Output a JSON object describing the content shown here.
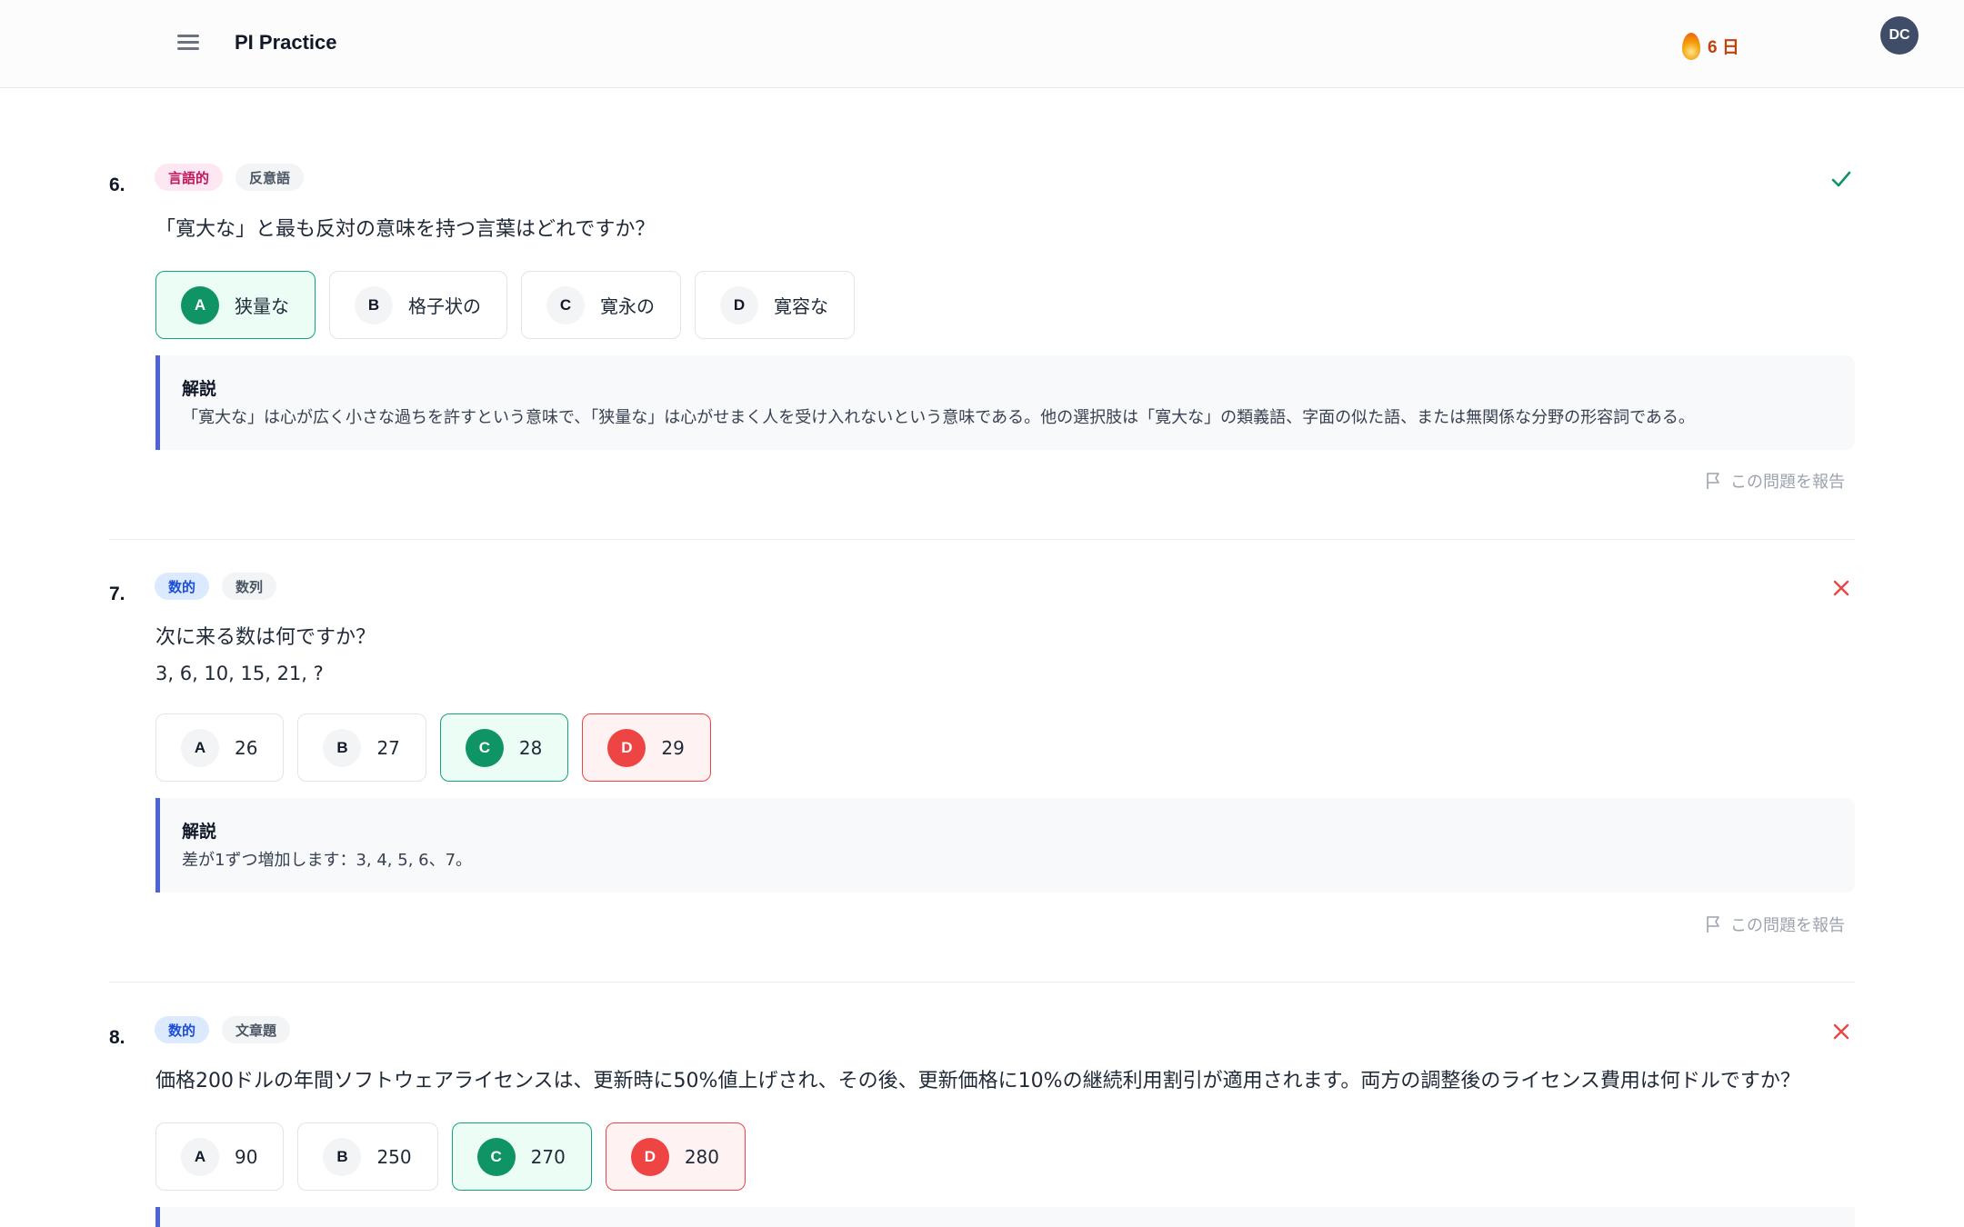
{
  "header": {
    "app_title": "PI Practice",
    "streak_text": "6 日",
    "avatar_initials": "DC"
  },
  "questions": [
    {
      "number": "6.",
      "tags": [
        "言語的",
        "反意語"
      ],
      "status": "correct",
      "text": "「寛大な」と最も反対の意味を持つ言葉はどれですか？",
      "options": [
        {
          "letter": "A",
          "text": "狭量な",
          "state": "correct"
        },
        {
          "letter": "B",
          "text": "格子状の",
          "state": "none"
        },
        {
          "letter": "C",
          "text": "寛永の",
          "state": "none"
        },
        {
          "letter": "D",
          "text": "寛容な",
          "state": "none"
        }
      ],
      "explanation_title": "解説",
      "explanation": "「寛大な」は心が広く小さな過ちを許すという意味で、「狭量な」は心がせまく人を受け入れないという意味である。他の選択肢は「寛大な」の類義語、字面の似た語、または無関係な分野の形容詞である。",
      "report_label": "この問題を報告"
    },
    {
      "number": "7.",
      "tags": [
        "数的",
        "数列"
      ],
      "status": "incorrect",
      "text": "次に来る数は何ですか？",
      "text2": "3, 6, 10, 15, 21, ?",
      "options": [
        {
          "letter": "A",
          "text": "26",
          "state": "none"
        },
        {
          "letter": "B",
          "text": "27",
          "state": "none"
        },
        {
          "letter": "C",
          "text": "28",
          "state": "correct"
        },
        {
          "letter": "D",
          "text": "29",
          "state": "wrong"
        }
      ],
      "explanation_title": "解説",
      "explanation": "差が1ずつ増加します：3, 4, 5, 6、7。",
      "report_label": "この問題を報告"
    },
    {
      "number": "8.",
      "tags": [
        "数的",
        "文章題"
      ],
      "status": "incorrect",
      "text": "価格200ドルの年間ソフトウェアライセンスは、更新時に50%値上げされ、その後、更新価格に10%の継続利用割引が適用されます。両方の調整後のライセンス費用は何ドルですか？",
      "options": [
        {
          "letter": "A",
          "text": "90",
          "state": "none"
        },
        {
          "letter": "B",
          "text": "250",
          "state": "none"
        },
        {
          "letter": "C",
          "text": "270",
          "state": "correct"
        },
        {
          "letter": "D",
          "text": "280",
          "state": "wrong"
        }
      ]
    }
  ],
  "colors": {
    "correct": "#0f9466",
    "wrong": "#ef4444",
    "accent": "#4f63d8",
    "streak": "#c2410c"
  },
  "icons": {
    "menu": "hamburger-icon",
    "streak": "flame-icon",
    "correct_status": "checkmark-icon",
    "incorrect_status": "x-icon",
    "report": "flag-icon"
  }
}
